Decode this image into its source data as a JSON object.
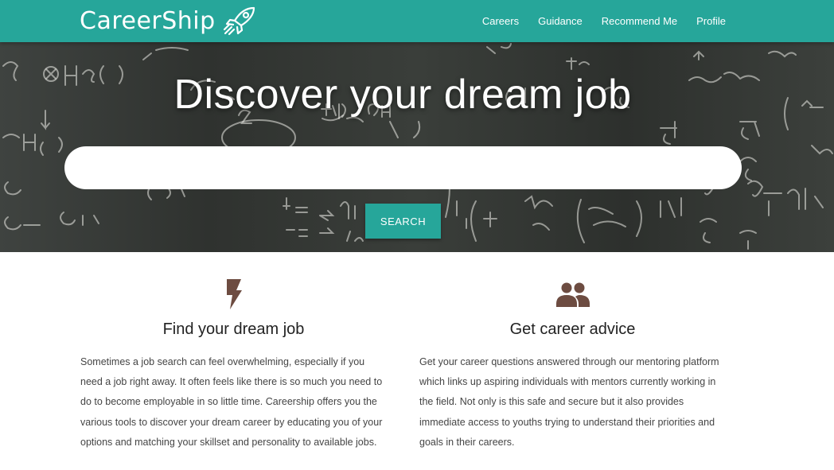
{
  "brand": {
    "name": "CareerShip",
    "logo_icon": "rocket-icon"
  },
  "nav": {
    "items": [
      {
        "label": "Careers"
      },
      {
        "label": "Guidance"
      },
      {
        "label": "Recommend Me"
      },
      {
        "label": "Profile"
      }
    ]
  },
  "hero": {
    "title": "Discover your dream job",
    "search_value": "",
    "search_placeholder": "",
    "search_button": "SEARCH"
  },
  "features": [
    {
      "icon": "lightning-bolt-icon",
      "title": "Find your dream job",
      "text": "Sometimes a job search can feel overwhelming, especially if you need a job right away. It often feels like there is so much you need to do to become employable in so little time. Careership offers you the various tools to discover your dream career by educating you of your options and matching your skillset and personality to available jobs."
    },
    {
      "icon": "people-icon",
      "title": "Get career advice",
      "text": "Get your career questions answered through our mentoring platform which links up aspiring individuals with mentors currently working in the field. Not only is this safe and secure but it also provides immediate access to youths trying to understand their priorities and goals in their careers."
    }
  ],
  "colors": {
    "primary": "#26a69a",
    "icon_brown": "#6d4c41",
    "hero_dark": "#333633"
  }
}
